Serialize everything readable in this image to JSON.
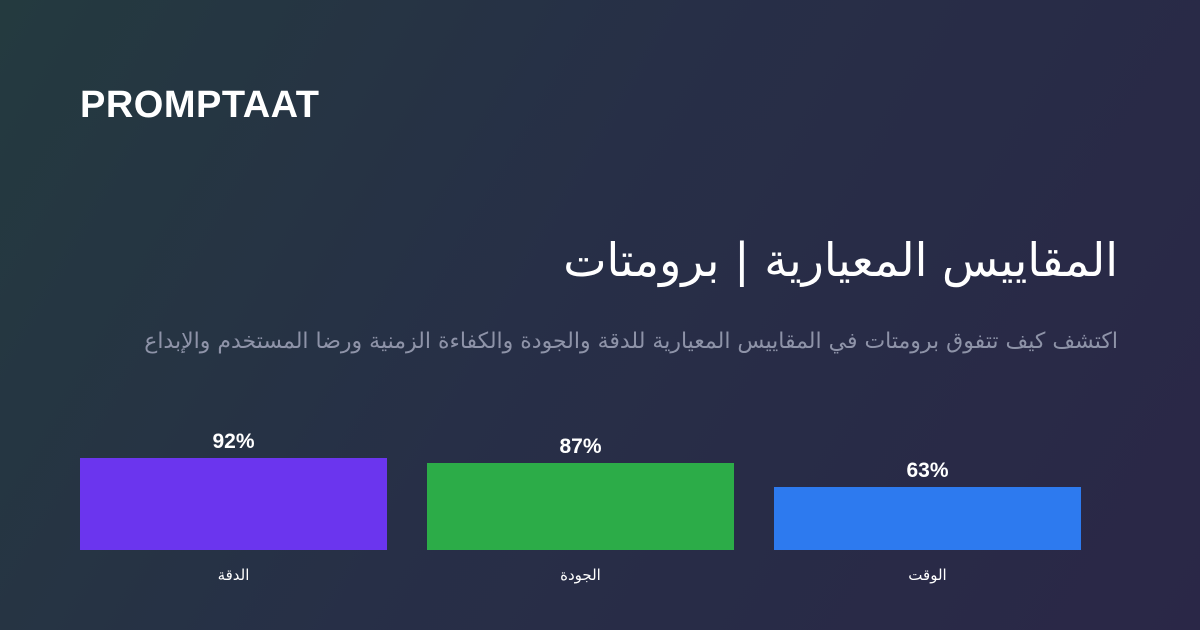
{
  "brand": "PROMPTAAT",
  "title": "المقاييس المعيارية | برومتات",
  "subtitle": "اكتشف كيف تتفوق برومتات في المقاييس المعيارية للدقة والجودة والكفاءة الزمنية ورضا المستخدم والإبداع",
  "chart_data": {
    "type": "bar",
    "categories": [
      "الدقة",
      "الجودة",
      "الوقت"
    ],
    "values": [
      92,
      87,
      63
    ],
    "value_labels": [
      "92%",
      "87%",
      "63%"
    ],
    "colors": [
      "#6b35ee",
      "#2cac48",
      "#2d7aef"
    ],
    "ylim": [
      0,
      100
    ],
    "grid": false,
    "title": "",
    "xlabel": "",
    "ylabel": ""
  }
}
